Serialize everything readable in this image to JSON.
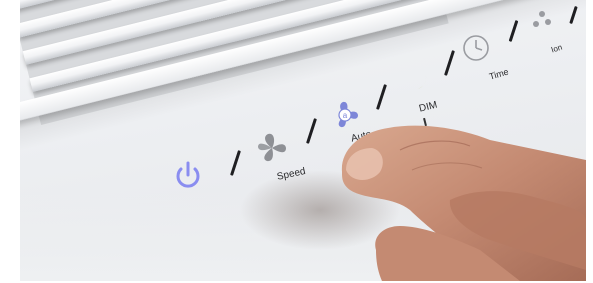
{
  "control_panel": {
    "speed_label": "Speed",
    "auto_label": "Auto",
    "dim_label": "DIM",
    "time_label": "Time",
    "ion_label": "Ion",
    "power_color": "#8a8df0",
    "auto_color": "#7d86d8",
    "moon_color": "#cdd4a2"
  },
  "icons": [
    "power-icon",
    "fan-icon",
    "auto-fan-icon",
    "moon-icon",
    "clock-icon",
    "ion-icon"
  ]
}
